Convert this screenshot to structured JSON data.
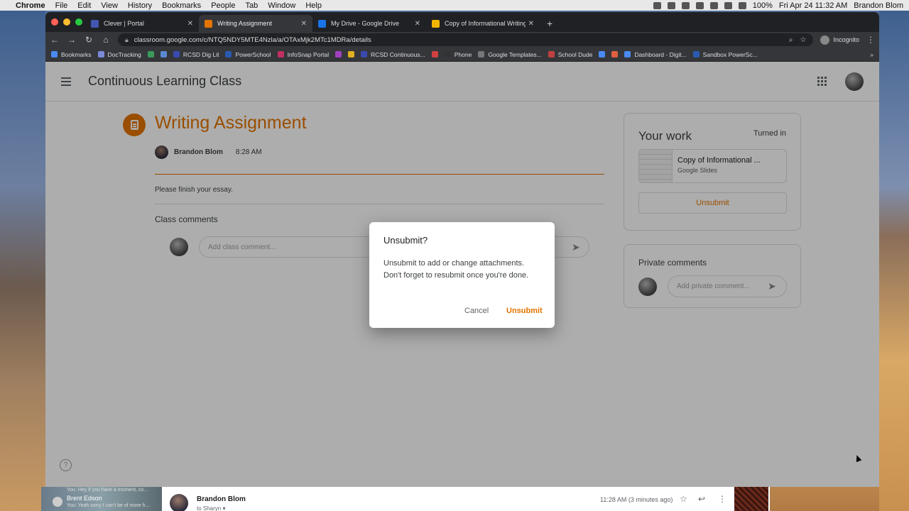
{
  "menubar": {
    "app": "Chrome",
    "items": [
      "File",
      "Edit",
      "View",
      "History",
      "Bookmarks",
      "People",
      "Tab",
      "Window",
      "Help"
    ],
    "battery": "100%",
    "datetime": "Fri Apr 24  11:32 AM",
    "user": "Brandon Blom"
  },
  "browser": {
    "tabs": [
      {
        "title": "Clever | Portal",
        "color": "#4257b2"
      },
      {
        "title": "Writing Assignment",
        "color": "#e37400"
      },
      {
        "title": "My Drive - Google Drive",
        "color": "#1a73e8"
      },
      {
        "title": "Copy of Informational Writing (",
        "color": "#f4b400"
      }
    ],
    "url": "classroom.google.com/c/NTQ5NDY5MTE4Nzla/a/OTAxMjk2MTc1MDRa/details",
    "incognito_label": "Incognito",
    "bookmarks": [
      "Bookmarks",
      "DocTracking",
      "",
      "",
      "RCSD Dig Lit",
      "PowerSchool",
      "InfoSnap Portal",
      "",
      "",
      "RCSD Continuous...",
      "",
      "Phone",
      "Google Templates...",
      "School Dude",
      "",
      "",
      "Dashboard - Digit...",
      "Sandbox PowerSc..."
    ]
  },
  "classroom": {
    "class_name": "Continuous Learning Class",
    "assignment_title": "Writing Assignment",
    "author": "Brandon Blom",
    "posted_time": "8:28 AM",
    "instructions": "Please finish your essay.",
    "class_comments_label": "Class comments",
    "class_comment_placeholder": "Add class comment...",
    "your_work": {
      "heading": "Your work",
      "status": "Turned in",
      "attachment_name": "Copy of Informational ...",
      "attachment_type": "Google Slides",
      "unsubmit_label": "Unsubmit"
    },
    "private_comments": {
      "heading": "Private comments",
      "placeholder": "Add private comment..."
    }
  },
  "dialog": {
    "title": "Unsubmit?",
    "body": "Unsubmit to add or change attachments. Don't forget to resubmit once you're done.",
    "cancel": "Cancel",
    "confirm": "Unsubmit"
  },
  "background_window": {
    "left_line1": "You: Hey if you have a moment, co...",
    "left_name": "Brent Edson",
    "left_line2": "You: Yeah sorry I can't be of more h...",
    "sender": "Brandon Blom",
    "to": "to Sharyn ▾",
    "time": "11:28 AM (3 minutes ago)"
  }
}
